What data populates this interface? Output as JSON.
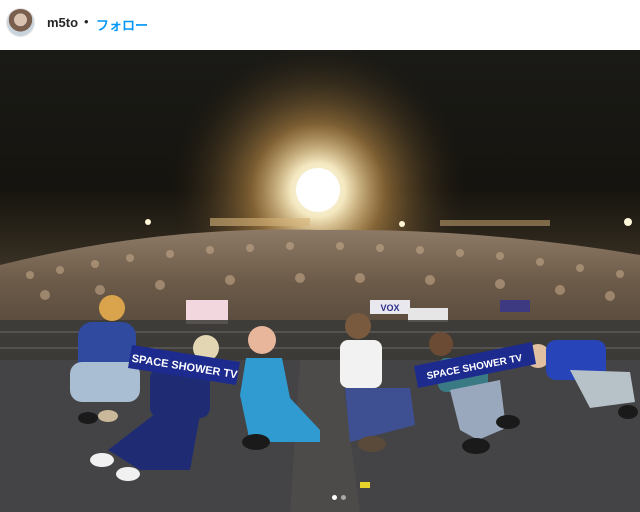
{
  "post": {
    "username": "m5to",
    "separator": "•",
    "follow_label": "フォロー"
  },
  "photo": {
    "banner_text": "SPACE SHOWER TV",
    "banner_text_2": "SPACE SHOWER TV",
    "crowd_sign_1": "VOX",
    "carousel": {
      "count": 2,
      "active_index": 0
    }
  }
}
